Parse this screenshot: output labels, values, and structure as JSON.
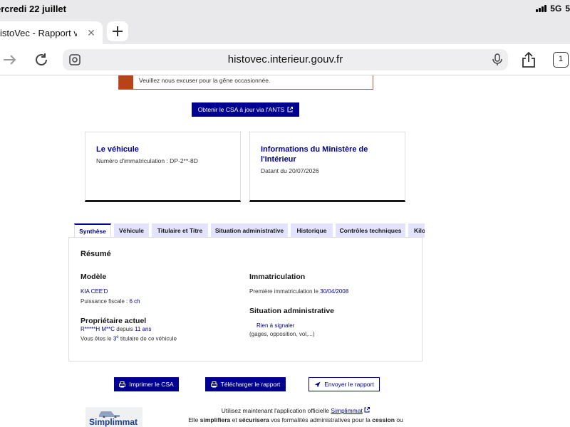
{
  "status": {
    "time": "ercredi 22 juillet",
    "network": "5G",
    "battery": "5"
  },
  "browser": {
    "tab_title": "istoVec - Rapport vend",
    "url": "histovec.interieur.gouv.fr",
    "tab_count": "1"
  },
  "alert": {
    "text": "Veuillez nous excuser pour la gêne occasionnée."
  },
  "csa_button": "Obtenir le CSA à jour via l'ANTS",
  "cards": {
    "vehicle": {
      "title": "Le véhicule",
      "desc": "Numéro d'immatriculation : DP-2**-8D"
    },
    "ministry": {
      "title_line1": "Informations du Ministère de",
      "title_line2": "l'Intérieur",
      "desc": "Datant du 20/07/2026"
    }
  },
  "tabs": [
    "Synthèse",
    "Véhicule",
    "Titulaire et Titre",
    "Situation administrative",
    "Historique",
    "Contrôles techniques",
    "Kilo"
  ],
  "summary": {
    "heading": "Résumé",
    "model_heading": "Modèle",
    "model": "KIA CEE'D",
    "fiscal_label": "Puissance fiscale :",
    "fiscal_value": "6 ch",
    "owner_heading": "Propriétaire actuel",
    "owner_name": "R*****H M**C",
    "owner_since_label": "depuis",
    "owner_since_value": "11 ans",
    "holder_prefix": "Vous êtes le",
    "holder_rank": "3",
    "holder_sup": "e",
    "holder_suffix": "titulaire de ce véhicule",
    "registration_heading": "Immatriculation",
    "first_reg_label": "Première immatriculation le",
    "first_reg_date": "30/04/2008",
    "admin_heading": "Situation administrative",
    "admin_status": "Rien à signaler",
    "admin_detail": "(gages, opposition, vol,...)"
  },
  "actions": {
    "print": "Imprimer le CSA",
    "download": "Télécharger le rapport",
    "send": "Envoyer le rapport"
  },
  "footer": {
    "logo": "Simplimmat",
    "line1_prefix": "Utilisez maintenant l'application officielle",
    "line1_link": "Simplimmat",
    "line2_a": "Elle",
    "line2_b": "simplifiera",
    "line2_c": "et",
    "line2_d": "sécurisera",
    "line2_e": "vos formalités administratives pour la",
    "line2_f": "cession",
    "line2_g": "ou"
  },
  "colors": {
    "primary": "#000091",
    "alert": "#b84318",
    "tab_bg": "#e3e3fd"
  }
}
